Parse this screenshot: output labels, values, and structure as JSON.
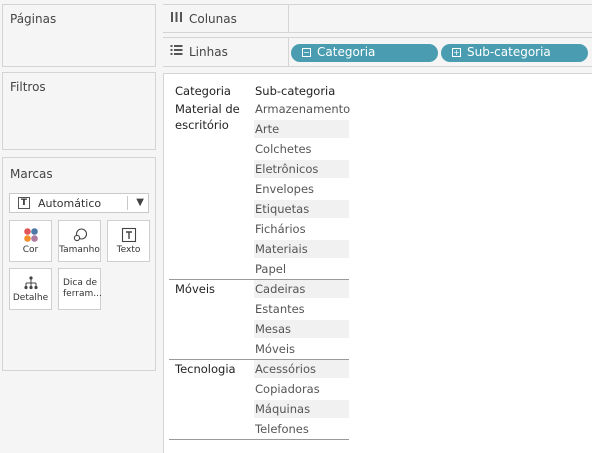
{
  "left_panels": {
    "pages": {
      "title": "Páginas"
    },
    "filters": {
      "title": "Filtros"
    },
    "marks": {
      "title": "Marcas",
      "mark_type": "Automático",
      "buttons": [
        {
          "label": "Cor",
          "icon": "color-dots-icon"
        },
        {
          "label": "Tamanho",
          "icon": "size-icon"
        },
        {
          "label": "Texto",
          "icon": "text-icon"
        },
        {
          "label": "Detalhe",
          "icon": "detail-icon"
        },
        {
          "label": "Dica de ferram...",
          "icon": "tooltip-icon"
        }
      ]
    }
  },
  "shelves": {
    "columns": {
      "label": "Colunas",
      "icon": "columns-icon",
      "pills": []
    },
    "rows": {
      "label": "Linhas",
      "icon": "rows-icon",
      "pills": [
        {
          "label": "Categoria",
          "sign": "⊟"
        },
        {
          "label": "Sub-categoria",
          "sign": "⊞"
        }
      ]
    }
  },
  "view": {
    "headers": [
      "Categoria",
      "Sub-categoria"
    ],
    "groups": [
      {
        "category": "Material de escritório",
        "subcategories": [
          "Armazenamento",
          "Arte",
          "Colchetes",
          "Eletrônicos",
          "Envelopes",
          "Etiquetas",
          "Fichários",
          "Materiais",
          "Papel"
        ]
      },
      {
        "category": "Móveis",
        "subcategories": [
          "Cadeiras",
          "Estantes",
          "Mesas",
          "Móveis"
        ]
      },
      {
        "category": "Tecnologia",
        "subcategories": [
          "Acessórios",
          "Copiadoras",
          "Máquinas",
          "Telefones"
        ]
      }
    ]
  },
  "colors": {
    "pill": "#4a9db1",
    "band": "#f1f1f1"
  }
}
